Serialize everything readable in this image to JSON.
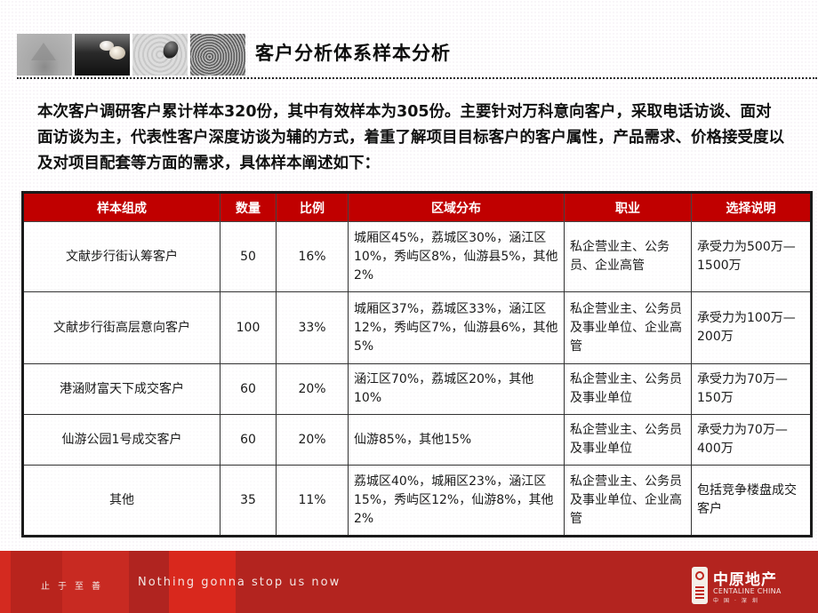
{
  "header": {
    "title": "客户分析体系样本分析",
    "thumbnails": [
      "sand-pyramid-image",
      "pebbles-image",
      "stone-ripples-image",
      "water-rings-image"
    ]
  },
  "intro": {
    "text": "本次客户调研客户累计样本320份，其中有效样本为305份。主要针对万科意向客户，采取电话访谈、面对面访谈为主，代表性客户深度访谈为辅的方式，着重了解项目目标客户的客户属性，产品需求、价格接受度以及对项目配套等方面的需求，具体样本阐述如下："
  },
  "table": {
    "headers": [
      "样本组成",
      "数量",
      "比例",
      "区域分布",
      "职业",
      "选择说明"
    ],
    "header_color": "#c00000",
    "rows": [
      {
        "group": "文献步行街认筹客户",
        "count": "50",
        "ratio": "16%",
        "region": "城厢区45%，荔城区30%，涵江区10%，秀屿区8%，仙游县5%，其他2%",
        "occupation": "私企营业主、公务员、企业高管",
        "note": "承受力为500万—1500万"
      },
      {
        "group": "文献步行街高层意向客户",
        "count": "100",
        "ratio": "33%",
        "region": "城厢区37%，荔城区33%，涵江区12%，秀屿区7%，仙游县6%，其他5%",
        "occupation": "私企营业主、公务员及事业单位、企业高管",
        "note": "承受力为100万—200万"
      },
      {
        "group": "港涵财富天下成交客户",
        "count": "60",
        "ratio": "20%",
        "region": "涵江区70%，荔城区20%，其他10%",
        "occupation": "私企营业主、公务员及事业单位",
        "note": "承受力为70万—150万"
      },
      {
        "group": "仙游公园1号成交客户",
        "count": "60",
        "ratio": "20%",
        "region": "仙游85%，其他15%",
        "occupation": "私企营业主、公务员及事业单位",
        "note": "承受力为70万—400万"
      },
      {
        "group": "其他",
        "count": "35",
        "ratio": "11%",
        "region": "荔城区40%，城厢区23%，涵江区15%，秀屿区12%，仙游8%，其他2%",
        "occupation": "私企营业主、公务员及事业单位、企业高管",
        "note": "包括竞争楼盘成交客户"
      }
    ]
  },
  "footer": {
    "motto_cn": "止于至善",
    "motto_en": "Nothing gonna stop us now",
    "logo_cn": "中原地产",
    "logo_en": "CENTALINE CHINA",
    "logo_sub": "中国·深圳",
    "brand_color": "#b8241d"
  }
}
